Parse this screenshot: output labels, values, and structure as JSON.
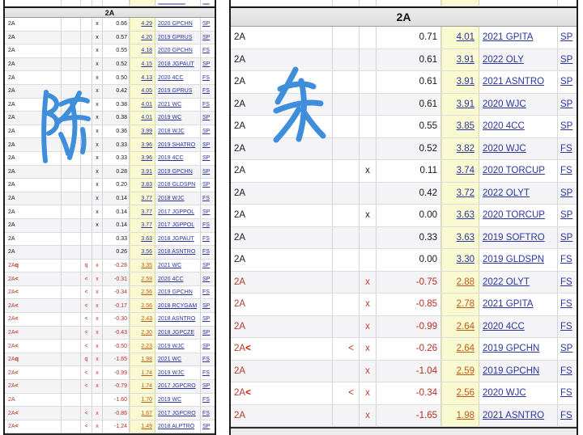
{
  "colors": {
    "highlight_yellow": "#FAFAD2",
    "link_navy": "#2B35A0",
    "negative_red": "#B52E22",
    "downgrade_score_orange": "#BF5A12",
    "handwriting_blue": "#3F8EDB"
  },
  "annotations": {
    "left_character": "陈",
    "right_character": "朱"
  },
  "panels": {
    "left": {
      "header": "2A",
      "rows": [
        {
          "el": "2A",
          "sfx": "",
          "mk": "",
          "x": "x",
          "goe": "0.66",
          "sc": "4.29",
          "ev": "2020 GPCHN",
          "sg": "SP",
          "neg": false
        },
        {
          "el": "2A",
          "sfx": "",
          "mk": "",
          "x": "x",
          "goe": "0.57",
          "sc": "4.20",
          "ev": "2019 GPRUS",
          "sg": "SP",
          "neg": false
        },
        {
          "el": "2A",
          "sfx": "",
          "mk": "",
          "x": "x",
          "goe": "0.55",
          "sc": "4.18",
          "ev": "2020 GPCHN",
          "sg": "FS",
          "neg": false
        },
        {
          "el": "2A",
          "sfx": "",
          "mk": "",
          "x": "x",
          "goe": "0.52",
          "sc": "4.15",
          "ev": "2018 JGPAUT",
          "sg": "SP",
          "neg": false
        },
        {
          "el": "2A",
          "sfx": "",
          "mk": "",
          "x": "x",
          "goe": "0.50",
          "sc": "4.13",
          "ev": "2020 4CC",
          "sg": "FS",
          "neg": false
        },
        {
          "el": "2A",
          "sfx": "",
          "mk": "",
          "x": "x",
          "goe": "0.42",
          "sc": "4.05",
          "ev": "2019 GPRUS",
          "sg": "FS",
          "neg": false
        },
        {
          "el": "2A",
          "sfx": "",
          "mk": "",
          "x": "x",
          "goe": "0.38",
          "sc": "4.01",
          "ev": "2021 WC",
          "sg": "FS",
          "neg": false
        },
        {
          "el": "2A",
          "sfx": "",
          "mk": "",
          "x": "x",
          "goe": "0.38",
          "sc": "4.01",
          "ev": "2019 WC",
          "sg": "SP",
          "neg": false
        },
        {
          "el": "2A",
          "sfx": "",
          "mk": "",
          "x": "x",
          "goe": "0.36",
          "sc": "3.99",
          "ev": "2018 WJC",
          "sg": "SP",
          "neg": false
        },
        {
          "el": "2A",
          "sfx": "",
          "mk": "",
          "x": "x",
          "goe": "0.33",
          "sc": "3.96",
          "ev": "2019 SHATRO",
          "sg": "SP",
          "neg": false
        },
        {
          "el": "2A",
          "sfx": "",
          "mk": "",
          "x": "x",
          "goe": "0.33",
          "sc": "3.96",
          "ev": "2019 4CC",
          "sg": "SP",
          "neg": false
        },
        {
          "el": "2A",
          "sfx": "",
          "mk": "",
          "x": "x",
          "goe": "0.28",
          "sc": "3.91",
          "ev": "2019 GPCHN",
          "sg": "SP",
          "neg": false
        },
        {
          "el": "2A",
          "sfx": "",
          "mk": "",
          "x": "x",
          "goe": "0.20",
          "sc": "3.83",
          "ev": "2018 GLDSPN",
          "sg": "SP",
          "neg": false
        },
        {
          "el": "2A",
          "sfx": "",
          "mk": "",
          "x": "x",
          "goe": "0.14",
          "sc": "3.77",
          "ev": "2018 WJC",
          "sg": "FS",
          "neg": false
        },
        {
          "el": "2A",
          "sfx": "",
          "mk": "",
          "x": "x",
          "goe": "0.14",
          "sc": "3.77",
          "ev": "2017 JGPPOL",
          "sg": "SP",
          "neg": false
        },
        {
          "el": "2A",
          "sfx": "",
          "mk": "",
          "x": "x",
          "goe": "0.14",
          "sc": "3.77",
          "ev": "2017 JGPPOL",
          "sg": "FS",
          "neg": false
        },
        {
          "el": "2A",
          "sfx": "",
          "mk": "",
          "x": "",
          "goe": "0.33",
          "sc": "3.63",
          "ev": "2018 JGPAUT",
          "sg": "FS",
          "neg": false
        },
        {
          "el": "2A",
          "sfx": "",
          "mk": "",
          "x": "",
          "goe": "0.26",
          "sc": "3.56",
          "ev": "2018 ASNTRO",
          "sg": "FS",
          "neg": false
        },
        {
          "el": "2A",
          "sfx": "q",
          "mk": "q",
          "x": "x",
          "goe": "-0.28",
          "sc": "3.35",
          "ev": "2021 WC",
          "sg": "SP",
          "neg": true
        },
        {
          "el": "2A",
          "sfx": "<",
          "mk": "<",
          "x": "x",
          "goe": "-0.31",
          "sc": "2.59",
          "ev": "2020 4CC",
          "sg": "SP",
          "neg": true
        },
        {
          "el": "2A",
          "sfx": "<",
          "mk": "<",
          "x": "x",
          "goe": "-0.34",
          "sc": "2.56",
          "ev": "2019 GPCHN",
          "sg": "FS",
          "neg": true
        },
        {
          "el": "2A",
          "sfx": "<",
          "mk": "<",
          "x": "x",
          "goe": "-0.17",
          "sc": "2.56",
          "ev": "2018 RCYGAM",
          "sg": "SP",
          "neg": true
        },
        {
          "el": "2A",
          "sfx": "<",
          "mk": "<",
          "x": "x",
          "goe": "-0.30",
          "sc": "2.43",
          "ev": "2018 ASNTRO",
          "sg": "SP",
          "neg": true
        },
        {
          "el": "2A",
          "sfx": "<",
          "mk": "<",
          "x": "x",
          "goe": "-0.43",
          "sc": "2.30",
          "ev": "2018 JGPCZE",
          "sg": "SP",
          "neg": true
        },
        {
          "el": "2A",
          "sfx": "<",
          "mk": "<",
          "x": "x",
          "goe": "-0.50",
          "sc": "2.23",
          "ev": "2019 WJC",
          "sg": "SP",
          "neg": true
        },
        {
          "el": "2A",
          "sfx": "q",
          "mk": "q",
          "x": "x",
          "goe": "-1.65",
          "sc": "1.98",
          "ev": "2021 WC",
          "sg": "FS",
          "neg": true
        },
        {
          "el": "2A",
          "sfx": "<",
          "mk": "<",
          "x": "x",
          "goe": "-0.99",
          "sc": "1.74",
          "ev": "2019 WJC",
          "sg": "FS",
          "neg": true
        },
        {
          "el": "2A",
          "sfx": "<",
          "mk": "<",
          "x": "x",
          "goe": "-0.79",
          "sc": "1.74",
          "ev": "2017 JGPCRO",
          "sg": "SP",
          "neg": true
        },
        {
          "el": "2A",
          "sfx": "",
          "mk": "",
          "x": "",
          "goe": "-1.60",
          "sc": "1.70",
          "ev": "2019 WC",
          "sg": "FS",
          "neg": true
        },
        {
          "el": "2A",
          "sfx": "<",
          "mk": "<",
          "x": "x",
          "goe": "-0.86",
          "sc": "1.67",
          "ev": "2017 JGPCRO",
          "sg": "FS",
          "neg": true
        },
        {
          "el": "2A",
          "sfx": "<",
          "mk": "<",
          "x": "x",
          "goe": "-1.24",
          "sc": "1.49",
          "ev": "2018 ALPTRO",
          "sg": "SP",
          "neg": true
        }
      ]
    },
    "right": {
      "header": "2A",
      "rows": [
        {
          "el": "2A",
          "sfx": "",
          "mk": "",
          "x": "",
          "goe": "0.71",
          "sc": "4.01",
          "ev": "2021 GPITA",
          "sg": "SP",
          "neg": false
        },
        {
          "el": "2A",
          "sfx": "",
          "mk": "",
          "x": "",
          "goe": "0.61",
          "sc": "3.91",
          "ev": "2022 OLY",
          "sg": "SP",
          "neg": false
        },
        {
          "el": "2A",
          "sfx": "",
          "mk": "",
          "x": "",
          "goe": "0.61",
          "sc": "3.91",
          "ev": "2021 ASNTRO",
          "sg": "SP",
          "neg": false
        },
        {
          "el": "2A",
          "sfx": "",
          "mk": "",
          "x": "",
          "goe": "0.61",
          "sc": "3.91",
          "ev": "2020 WJC",
          "sg": "SP",
          "neg": false
        },
        {
          "el": "2A",
          "sfx": "",
          "mk": "",
          "x": "",
          "goe": "0.55",
          "sc": "3.85",
          "ev": "2020 4CC",
          "sg": "SP",
          "neg": false
        },
        {
          "el": "2A",
          "sfx": "",
          "mk": "",
          "x": "",
          "goe": "0.52",
          "sc": "3.82",
          "ev": "2020 WJC",
          "sg": "FS",
          "neg": false
        },
        {
          "el": "2A",
          "sfx": "",
          "mk": "",
          "x": "x",
          "goe": "0.11",
          "sc": "3.74",
          "ev": "2020 TORCUP",
          "sg": "FS",
          "neg": false
        },
        {
          "el": "2A",
          "sfx": "",
          "mk": "",
          "x": "",
          "goe": "0.42",
          "sc": "3.72",
          "ev": "2022 OLYT",
          "sg": "SP",
          "neg": false
        },
        {
          "el": "2A",
          "sfx": "",
          "mk": "",
          "x": "x",
          "goe": "0.00",
          "sc": "3.63",
          "ev": "2020 TORCUP",
          "sg": "SP",
          "neg": false
        },
        {
          "el": "2A",
          "sfx": "",
          "mk": "",
          "x": "",
          "goe": "0.33",
          "sc": "3.63",
          "ev": "2019 SOFTRO",
          "sg": "SP",
          "neg": false
        },
        {
          "el": "2A",
          "sfx": "",
          "mk": "",
          "x": "",
          "goe": "0.00",
          "sc": "3.30",
          "ev": "2019 GLDSPN",
          "sg": "FS",
          "neg": false
        },
        {
          "el": "2A",
          "sfx": "",
          "mk": "",
          "x": "x",
          "goe": "-0.75",
          "sc": "2.88",
          "ev": "2022 OLYT",
          "sg": "FS",
          "neg": true
        },
        {
          "el": "2A",
          "sfx": "",
          "mk": "",
          "x": "x",
          "goe": "-0.85",
          "sc": "2.78",
          "ev": "2021 GPITA",
          "sg": "FS",
          "neg": true
        },
        {
          "el": "2A",
          "sfx": "",
          "mk": "",
          "x": "x",
          "goe": "-0.99",
          "sc": "2.64",
          "ev": "2020 4CC",
          "sg": "FS",
          "neg": true
        },
        {
          "el": "2A",
          "sfx": "<",
          "mk": "<",
          "x": "x",
          "goe": "-0.26",
          "sc": "2.64",
          "ev": "2019 GPCHN",
          "sg": "SP",
          "neg": true
        },
        {
          "el": "2A",
          "sfx": "",
          "mk": "",
          "x": "x",
          "goe": "-1.04",
          "sc": "2.59",
          "ev": "2019 GPCHN",
          "sg": "FS",
          "neg": true
        },
        {
          "el": "2A",
          "sfx": "<",
          "mk": "<",
          "x": "x",
          "goe": "-0.34",
          "sc": "2.56",
          "ev": "2020 WJC",
          "sg": "FS",
          "neg": true
        },
        {
          "el": "2A",
          "sfx": "",
          "mk": "",
          "x": "x",
          "goe": "-1.65",
          "sc": "1.98",
          "ev": "2021 ASNTRO",
          "sg": "FS",
          "neg": true
        }
      ]
    }
  }
}
